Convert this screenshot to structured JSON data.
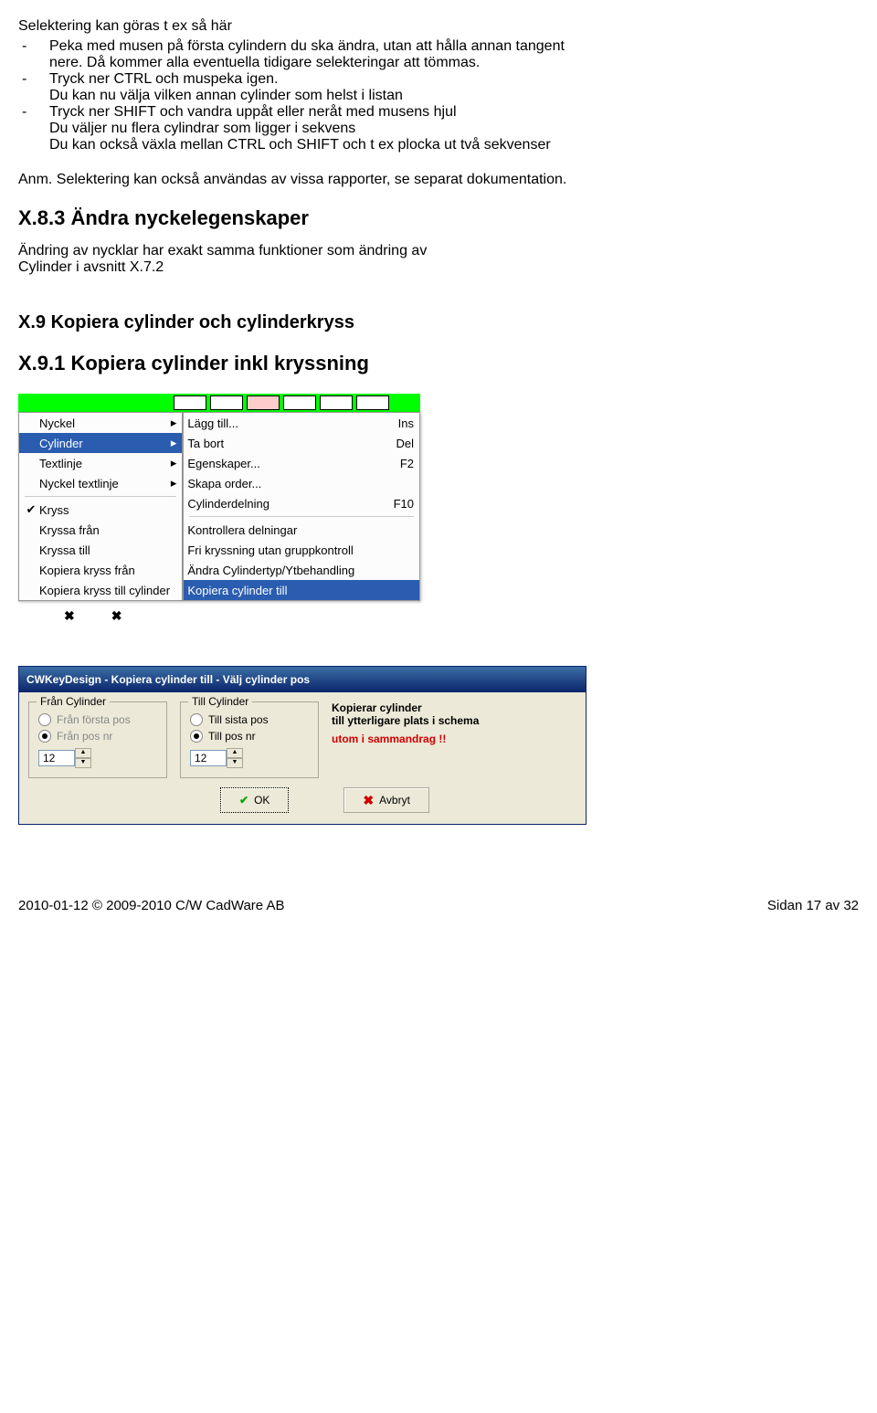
{
  "intro_line": "Selektering kan göras t ex så här",
  "bullets1": [
    {
      "text_a": "Peka med musen på första cylindern du ska ändra, utan att hålla annan tangent",
      "text_b": "nere. Då kommer alla eventuella tidigare selekteringar att tömmas."
    },
    {
      "text_a": "Tryck ner CTRL och muspeka igen.",
      "text_b": "Du kan nu välja vilken annan cylinder som helst i listan"
    },
    {
      "text_a": "Tryck ner SHIFT och vandra uppåt eller neråt med musens hjul",
      "text_b": "Du väljer nu flera cylindrar som ligger i sekvens",
      "text_c": "Du kan också växla mellan CTRL och SHIFT och t ex plocka ut två sekvenser"
    }
  ],
  "anm": "Anm. Selektering kan också användas av vissa rapporter, se separat dokumentation.",
  "h_x83": "X.8.3 Ändra nyckelegenskaper",
  "x83_text_a": "Ändring av nycklar har exakt samma funktioner som ändring av",
  "x83_text_b": "Cylinder i avsnitt X.7.2",
  "h_x9": "X.9 Kopiera cylinder och cylinderkryss",
  "h_x91": "X.9.1 Kopiera cylinder inkl kryssning",
  "menu_left": [
    {
      "label": "Nyckel",
      "arrow": true
    },
    {
      "label": "Cylinder",
      "arrow": true,
      "selected": true
    },
    {
      "label": "Textlinje",
      "arrow": true
    },
    {
      "label": "Nyckel textlinje",
      "arrow": true
    },
    {
      "sep": true
    },
    {
      "label": "Kryss",
      "check": true
    },
    {
      "label": "Kryssa från"
    },
    {
      "label": "Kryssa till"
    },
    {
      "label": "Kopiera kryss från"
    },
    {
      "label": "Kopiera kryss till cylinder"
    }
  ],
  "menu_right": [
    {
      "label": "Lägg till...",
      "shortcut": "Ins"
    },
    {
      "label": "Ta bort",
      "shortcut": "Del"
    },
    {
      "label": "Egenskaper...",
      "shortcut": "F2"
    },
    {
      "label": "Skapa order..."
    },
    {
      "label": "Cylinderdelning",
      "shortcut": "F10"
    },
    {
      "sep": true
    },
    {
      "label": "Kontrollera delningar"
    },
    {
      "label": "Fri kryssning utan gruppkontroll"
    },
    {
      "label": "Ändra Cylindertyp/Ytbehandling"
    },
    {
      "label": "Kopiera cylinder till",
      "selected": true
    }
  ],
  "dialog": {
    "title": "CWKeyDesign - Kopiera cylinder till - Välj cylinder pos",
    "from_group": "Från Cylinder",
    "from_opt1": "Från första pos",
    "from_opt2": "Från pos nr",
    "from_value": "12",
    "to_group": "Till Cylinder",
    "to_opt1": "Till sista pos",
    "to_opt2": "Till pos nr",
    "to_value": "12",
    "info1": "Kopierar cylinder",
    "info2": "till ytterligare plats i schema",
    "info3": "utom i sammandrag !!",
    "ok": "OK",
    "cancel": "Avbryt"
  },
  "footer": {
    "left": "2010-01-12  © 2009-2010 C/W CadWare AB",
    "right": "Sidan 17 av 32"
  }
}
